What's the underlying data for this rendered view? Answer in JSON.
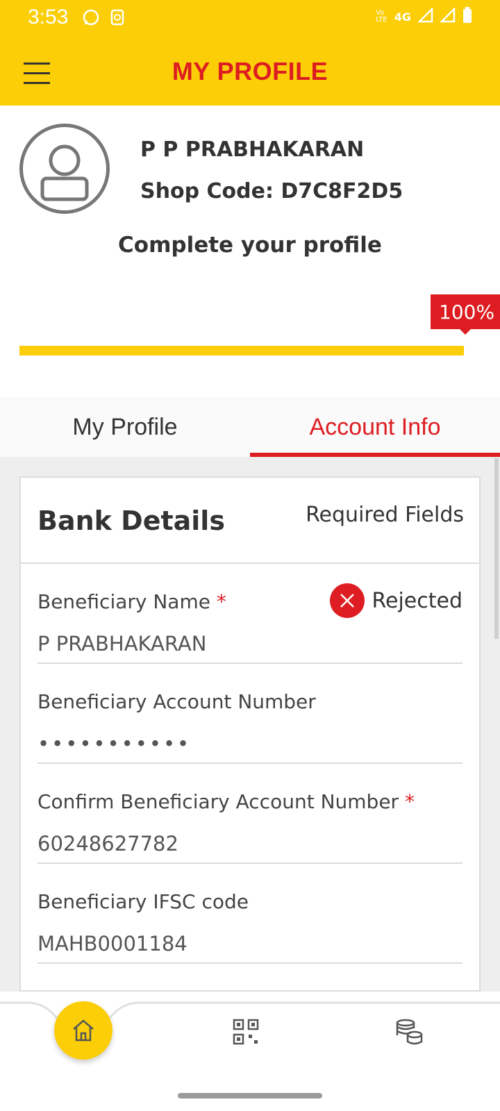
{
  "status_bar": {
    "time": "3:53",
    "network": "4G"
  },
  "header": {
    "title": "MY PROFILE"
  },
  "profile": {
    "name": "P P PRABHAKARAN",
    "shop_code": "Shop Code: D7C8F2D5",
    "complete_text": "Complete your profile",
    "completion_label": "100%",
    "completion_fraction": 1.0
  },
  "tabs": [
    {
      "label": "My Profile",
      "active": false
    },
    {
      "label": "Account Info",
      "active": true
    }
  ],
  "bank_details": {
    "title": "Bank Details",
    "required_label": "Required Fields",
    "status_label": "Rejected",
    "fields": [
      {
        "label": "Beneficiary Name",
        "required": "*",
        "value": "P PRABHAKARAN"
      },
      {
        "label": "Beneficiary Account Number",
        "required": "",
        "value": "•••••••••••"
      },
      {
        "label": "Confirm Beneficiary Account Number",
        "required": "*",
        "value": "60248627782"
      },
      {
        "label": "Beneficiary IFSC code",
        "required": "",
        "value": "MAHB0001184"
      }
    ]
  },
  "bottom_nav": {
    "items": [
      "home-icon",
      "qr-code-icon",
      "coins-icon"
    ]
  },
  "colors": {
    "brand_yellow": "#FBCE07",
    "brand_red": "#DD1D21",
    "text_dark": "#333333"
  }
}
